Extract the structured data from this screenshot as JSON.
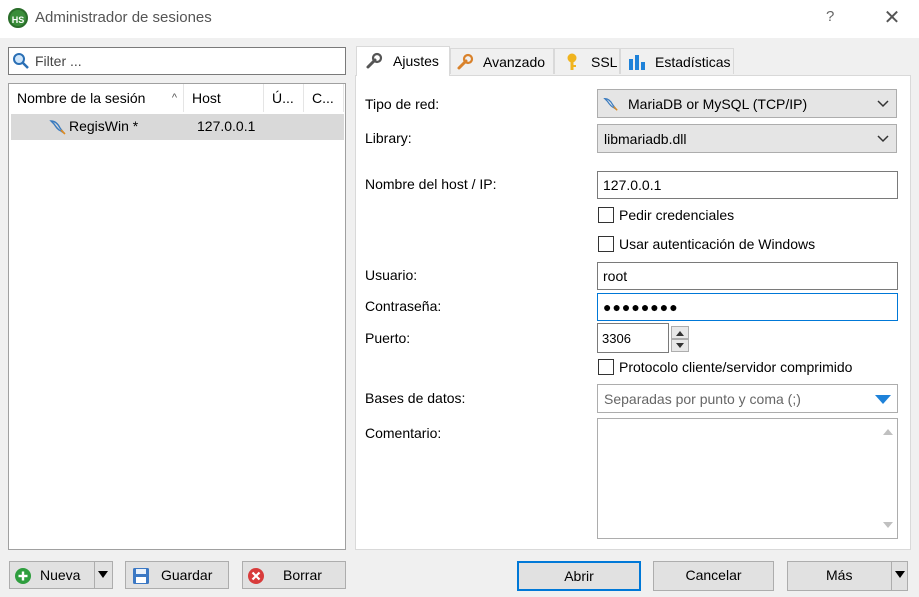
{
  "window": {
    "title": "Administrador de sesiones",
    "app_icon": "HS",
    "help_label": "?",
    "close_label": "✕"
  },
  "filter": {
    "placeholder": "Filter ..."
  },
  "session_list": {
    "columns": [
      "Nombre de la sesión",
      "Host",
      "Ú...",
      "C..."
    ],
    "sort_indicator": "^",
    "rows": [
      {
        "name": "RegisWin *",
        "host": "127.0.0.1",
        "icon": "dolphin-icon"
      }
    ]
  },
  "left_buttons": {
    "new": "Nueva",
    "save": "Guardar",
    "delete": "Borrar"
  },
  "tabs": [
    {
      "label": "Ajustes",
      "icon": "wrench-icon",
      "active": true
    },
    {
      "label": "Avanzado",
      "icon": "wrench-orange-icon",
      "active": false
    },
    {
      "label": "SSL",
      "icon": "key-icon",
      "active": false
    },
    {
      "label": "Estadísticas",
      "icon": "bar-chart-icon",
      "active": false
    }
  ],
  "settings": {
    "network_type_label": "Tipo de red:",
    "network_type_value": "MariaDB or MySQL (TCP/IP)",
    "library_label": "Library:",
    "library_value": "libmariadb.dll",
    "host_label": "Nombre del host / IP:",
    "host_value": "127.0.0.1",
    "prompt_credentials": "Pedir credenciales",
    "windows_auth": "Usar autenticación de Windows",
    "user_label": "Usuario:",
    "user_value": "root",
    "password_label": "Contraseña:",
    "password_value": "●●●●●●●●",
    "port_label": "Puerto:",
    "port_value": "3306",
    "compressed": "Protocolo cliente/servidor comprimido",
    "databases_label": "Bases de datos:",
    "databases_placeholder": "Separadas por punto y coma (;)",
    "comment_label": "Comentario:"
  },
  "right_buttons": {
    "open": "Abrir",
    "cancel": "Cancelar",
    "more": "Más"
  },
  "colors": {
    "accent": "#0078d7",
    "selected_row": "#d9d9d9",
    "new_icon": "#2e9e3e",
    "delete_icon": "#d83b3b"
  }
}
